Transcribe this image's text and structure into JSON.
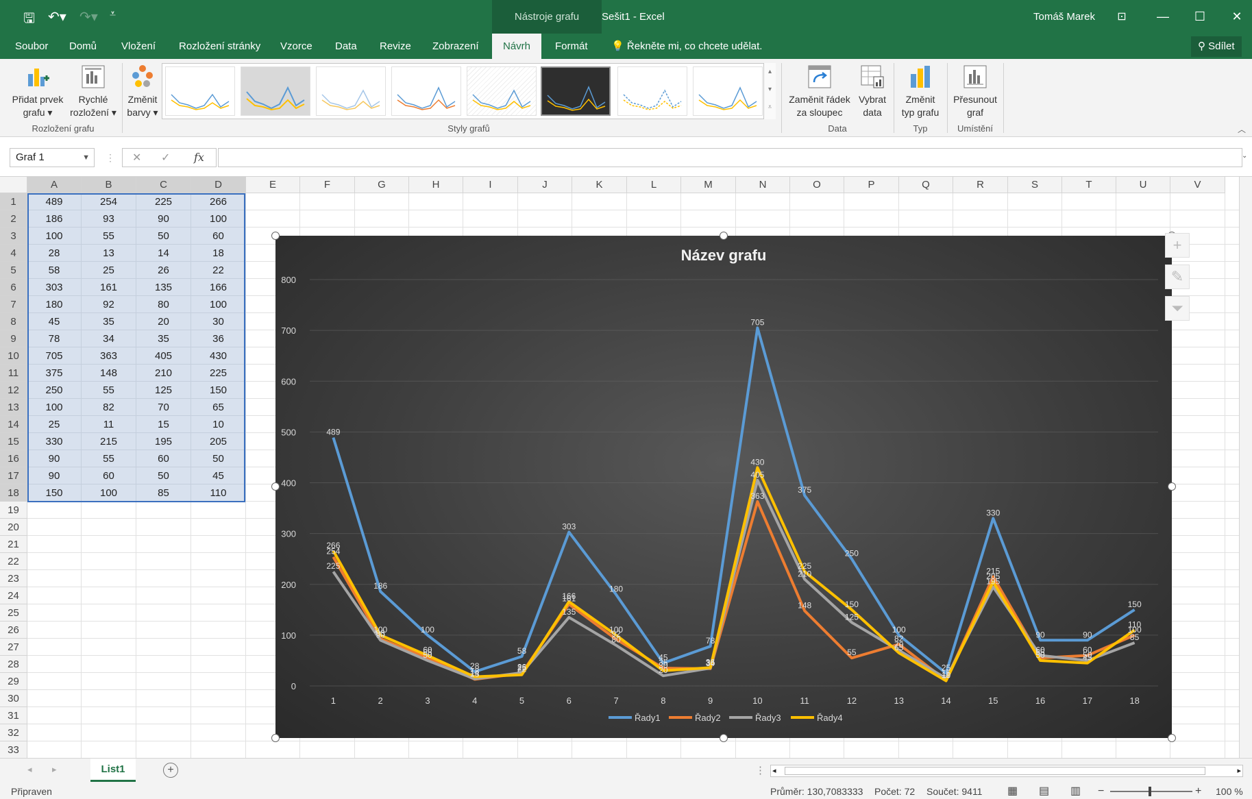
{
  "titlebar": {
    "context_tab": "Nástroje grafu",
    "doc_title": "Sešit1 - Excel",
    "user": "Tomáš Marek"
  },
  "tabs": [
    "Soubor",
    "Domů",
    "Vložení",
    "Rozložení stránky",
    "Vzorce",
    "Data",
    "Revize",
    "Zobrazení",
    "Návrh",
    "Formát"
  ],
  "tellme": "Řekněte mi, co chcete udělat.",
  "share": "Sdílet",
  "ribbon": {
    "add_element": [
      "Přidat prvek",
      "grafu ▾"
    ],
    "quick_layout": [
      "Rychlé",
      "rozložení ▾"
    ],
    "change_colors": [
      "Změnit",
      "barvy ▾"
    ],
    "switch_row_col": [
      "Zaměnit řádek",
      "za sloupec"
    ],
    "select_data": [
      "Vybrat",
      "data"
    ],
    "change_type": [
      "Změnit",
      "typ grafu"
    ],
    "move_chart": [
      "Přesunout",
      "graf"
    ],
    "groups": {
      "layout": "Rozložení grafu",
      "styles": "Styly grafů",
      "data": "Data",
      "type": "Typ",
      "location": "Umístění"
    }
  },
  "namebox": "Graf 1",
  "columns": [
    "A",
    "B",
    "C",
    "D",
    "E",
    "F",
    "G",
    "H",
    "I",
    "J",
    "K",
    "L",
    "M",
    "N",
    "O",
    "P",
    "Q",
    "R",
    "S",
    "T",
    "U",
    "V"
  ],
  "rows": [
    "1",
    "2",
    "3",
    "4",
    "5",
    "6",
    "7",
    "8",
    "9",
    "10",
    "11",
    "12",
    "13",
    "14",
    "15",
    "16",
    "17",
    "18",
    "19",
    "20",
    "21",
    "22",
    "23",
    "24",
    "25",
    "26",
    "27",
    "28",
    "29",
    "30",
    "31",
    "32",
    "33"
  ],
  "table": [
    [
      489,
      254,
      225,
      266
    ],
    [
      186,
      93,
      90,
      100
    ],
    [
      100,
      55,
      50,
      60
    ],
    [
      28,
      13,
      14,
      18
    ],
    [
      58,
      25,
      26,
      22
    ],
    [
      303,
      161,
      135,
      166
    ],
    [
      180,
      92,
      80,
      100
    ],
    [
      45,
      35,
      20,
      30
    ],
    [
      78,
      34,
      35,
      36
    ],
    [
      705,
      363,
      405,
      430
    ],
    [
      375,
      148,
      210,
      225
    ],
    [
      250,
      55,
      125,
      150
    ],
    [
      100,
      82,
      70,
      65
    ],
    [
      25,
      11,
      15,
      10
    ],
    [
      330,
      215,
      195,
      205
    ],
    [
      90,
      55,
      60,
      50
    ],
    [
      90,
      60,
      50,
      45
    ],
    [
      150,
      100,
      85,
      110
    ]
  ],
  "chart_data": {
    "type": "line",
    "title": "Název grafu",
    "x": [
      1,
      2,
      3,
      4,
      5,
      6,
      7,
      8,
      9,
      10,
      11,
      12,
      13,
      14,
      15,
      16,
      17,
      18
    ],
    "ylim": [
      0,
      800
    ],
    "yticks": [
      0,
      100,
      200,
      300,
      400,
      500,
      600,
      700,
      800
    ],
    "grid": true,
    "legend": "bottom",
    "series": [
      {
        "name": "Řady1",
        "color": "#5b9bd5",
        "values": [
          489,
          186,
          100,
          28,
          58,
          303,
          180,
          45,
          78,
          705,
          375,
          250,
          100,
          25,
          330,
          90,
          90,
          150
        ]
      },
      {
        "name": "Řady2",
        "color": "#ed7d31",
        "values": [
          254,
          93,
          55,
          13,
          25,
          161,
          92,
          35,
          34,
          363,
          148,
          55,
          82,
          11,
          215,
          55,
          60,
          100
        ]
      },
      {
        "name": "Řady3",
        "color": "#a5a5a5",
        "values": [
          225,
          90,
          50,
          14,
          26,
          135,
          80,
          20,
          35,
          405,
          210,
          125,
          70,
          15,
          195,
          60,
          50,
          85
        ]
      },
      {
        "name": "Řady4",
        "color": "#ffc000",
        "values": [
          266,
          100,
          60,
          18,
          22,
          166,
          100,
          30,
          36,
          430,
          225,
          150,
          65,
          10,
          205,
          50,
          45,
          110
        ]
      }
    ]
  },
  "sheet_tab": "List1",
  "status": {
    "ready": "Připraven",
    "average": "Průměr: 130,7083333",
    "count": "Počet: 72",
    "sum": "Součet: 9411",
    "zoom": "100 %"
  }
}
